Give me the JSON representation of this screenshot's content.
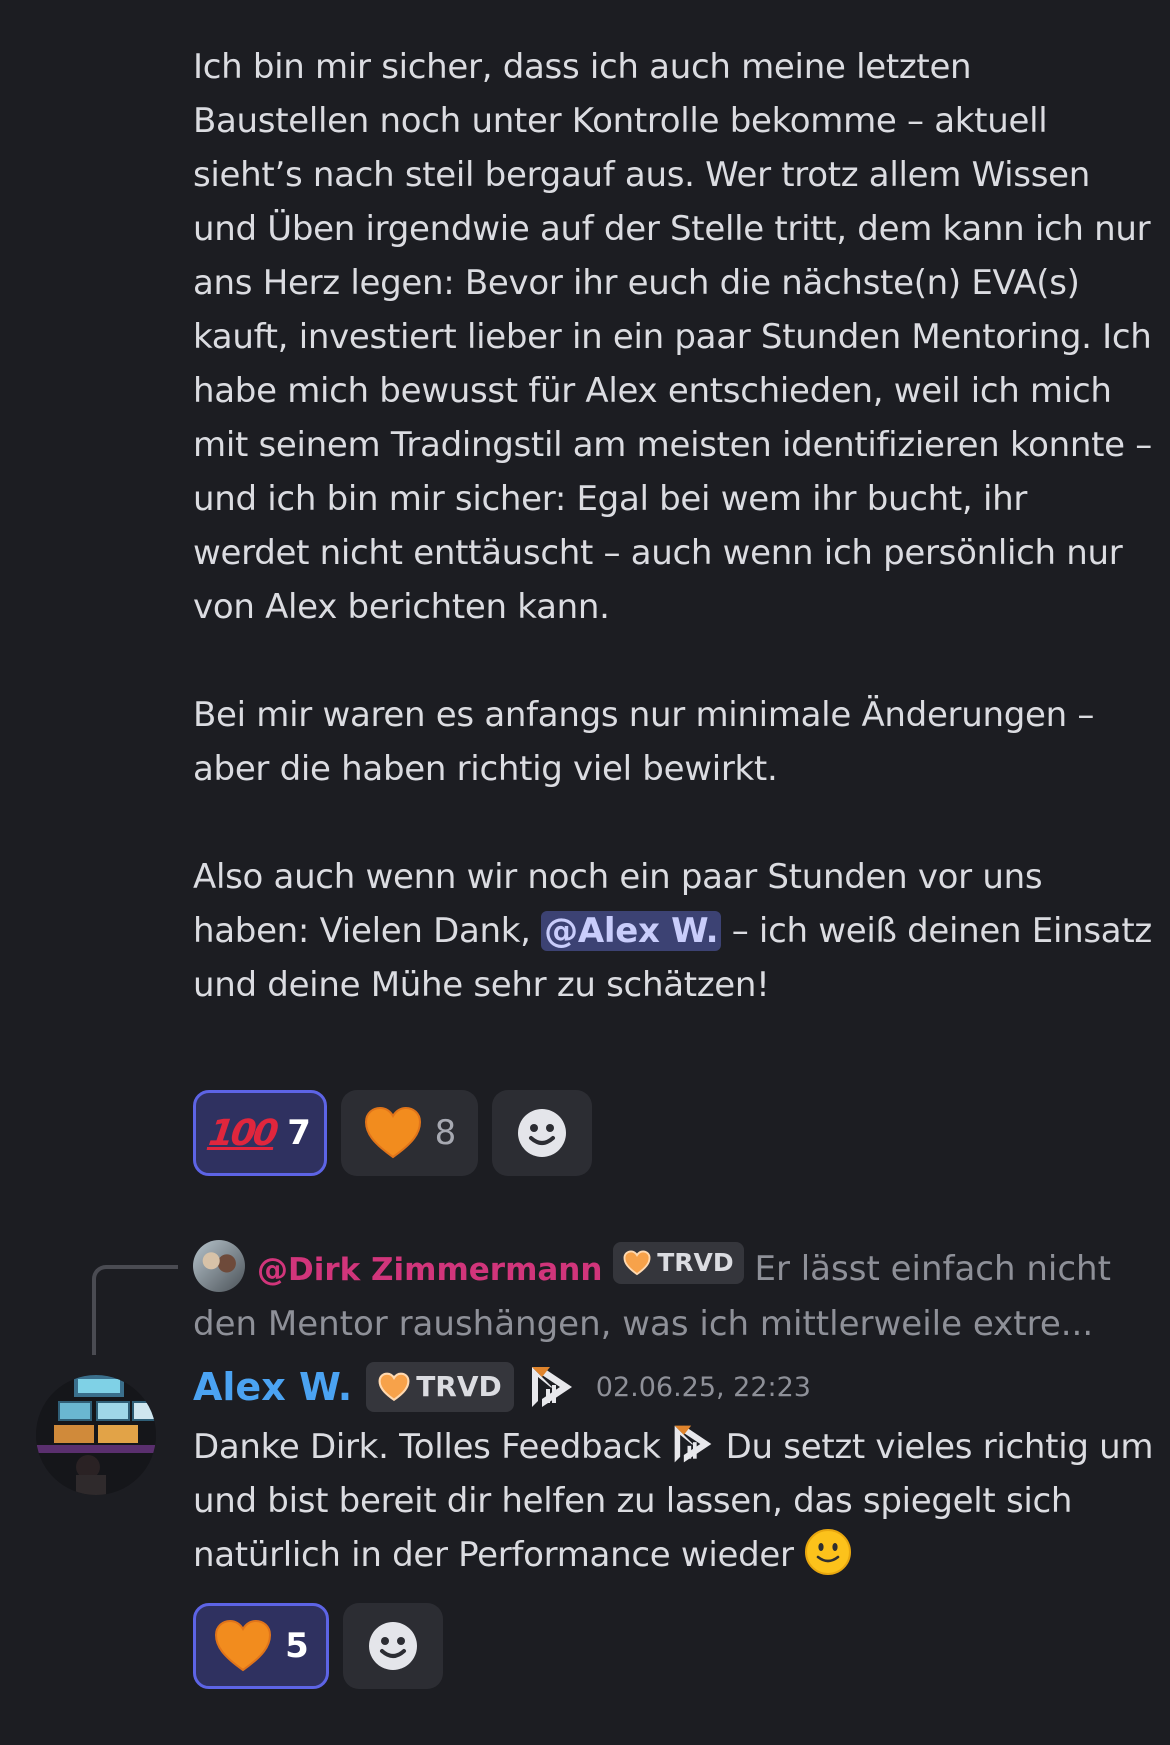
{
  "message1": {
    "paragraphs": [
      "Ich bin mir sicher, dass ich auch meine letzten Baustellen noch unter Kontrolle bekomme – aktuell sieht’s nach steil bergauf aus. Wer trotz allem Wissen und Üben irgendwie auf der Stelle tritt, dem kann ich nur ans Herz legen: Bevor ihr euch die nächste(n) EVA(s) kauft, investiert lieber in ein paar Stunden Mentoring. Ich habe mich bewusst für Alex entschieden, weil ich mich mit seinem Tradingstil am meisten identifizieren konnte – und ich bin mir sicher: Egal bei wem ihr bucht, ihr werdet nicht enttäuscht – auch wenn ich persönlich nur von Alex berichten kann.",
      "Bei mir waren es anfangs nur minimale Änderungen – aber die haben richtig viel bewirkt."
    ],
    "last_paragraph_before": "Also auch wenn wir noch ein paar Stunden vor uns haben: Vielen Dank, ",
    "mention": "@Alex W.",
    "last_paragraph_after": "  – ich weiß deinen Einsatz und deine Mühe sehr zu schätzen!",
    "reactions": [
      {
        "emoji": "💯",
        "count": "7",
        "reacted": true
      },
      {
        "emoji": "🧡",
        "count": "8",
        "reacted": false
      }
    ]
  },
  "reply_preview": {
    "name": "@Dirk Zimmermann",
    "tag": "TRVD",
    "text": "Er lässt einfach nicht den Mentor raushängen, was ich mittlerweile extre..."
  },
  "message2": {
    "author": "Alex W.",
    "tag": "TRVD",
    "timestamp": "02.06.25, 22:23",
    "body_part1": "Danke Dirk. Tolles Feedback ",
    "body_part2": " Du setzt vieles richtig um und bist bereit dir helfen zu lassen, das spiegelt sich natürlich in der Performance wieder ",
    "reactions": [
      {
        "emoji": "🧡",
        "count": "5",
        "reacted": true
      }
    ]
  },
  "colors": {
    "background": "#1c1d22",
    "mention_bg": "#3c4273",
    "author": "#4ba3f2",
    "reply_name": "#d1357b",
    "reaction_border": "#5d64e6",
    "heart": "#f28c1e"
  },
  "icons": [
    "hundred-points-icon",
    "orange-heart-icon",
    "add-reaction-icon",
    "trvd-logo-icon",
    "slightly-smiling-face-icon"
  ]
}
